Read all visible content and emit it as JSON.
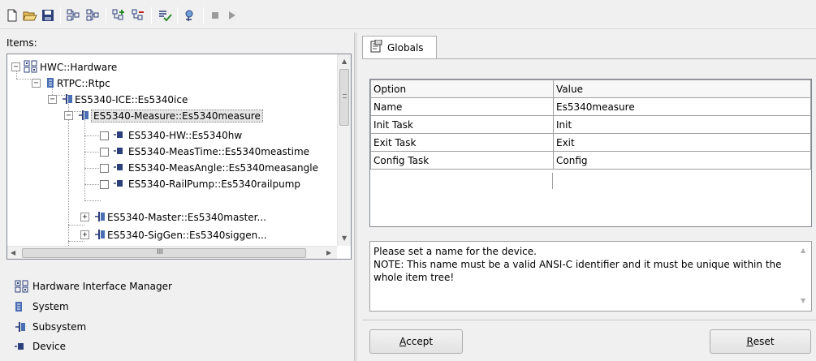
{
  "toolbar": {
    "buttons": [
      "new-icon",
      "open-icon",
      "save-icon",
      "add-item-icon",
      "remove-item-icon",
      "add-subitem-icon",
      "remove-subitem-icon",
      "check-icon",
      "search-icon",
      "stop-icon",
      "run-icon"
    ]
  },
  "left": {
    "items_label": "Items:",
    "tree": [
      {
        "label": "HWC::Hardware",
        "type": "hwm",
        "expander": "-"
      },
      {
        "label": "RTPC::Rtpc",
        "type": "system",
        "expander": "-"
      },
      {
        "label": "ES5340-ICE::Es5340ice",
        "type": "subsystem",
        "expander": "-"
      },
      {
        "label": "ES5340-Measure::Es5340measure",
        "type": "subsystem",
        "expander": "-",
        "selected": true
      },
      {
        "label": "ES5340-HW::Es5340hw",
        "type": "device"
      },
      {
        "label": "ES5340-MeasTime::Es5340meastime",
        "type": "device"
      },
      {
        "label": "ES5340-MeasAngle::Es5340measangle",
        "type": "device"
      },
      {
        "label": "ES5340-RailPump::Es5340railpump",
        "type": "device"
      },
      {
        "label": "ES5340-Master::Es5340master...",
        "type": "subsystem",
        "expander": "+"
      },
      {
        "label": "ES5340-SigGen::Es5340siggen...",
        "type": "subsystem",
        "expander": "+"
      }
    ],
    "hscroll_grip": "III",
    "legend": {
      "hwm": "Hardware Interface Manager",
      "system": "System",
      "subsystem": "Subsystem",
      "device": "Device"
    }
  },
  "right": {
    "tab_label": "Globals",
    "table": {
      "headers": [
        "Option",
        "Value"
      ],
      "rows": [
        [
          "Name",
          "Es5340measure"
        ],
        [
          "Init Task",
          "Init"
        ],
        [
          "Exit Task",
          "Exit"
        ],
        [
          "Config Task",
          "Config"
        ]
      ]
    },
    "description": "Please set a name for the device.\nNOTE: This name must be a valid ANSI-C identifier and it must be unique within the whole item tree!",
    "accept_prefix": "A",
    "accept_rest": "ccept",
    "reset_prefix": "R",
    "reset_rest": "eset"
  },
  "colors": {
    "icon_blue": "#4a6fb5",
    "icon_dark": "#2b3f7a",
    "run_gray": "#9b9b9b"
  }
}
